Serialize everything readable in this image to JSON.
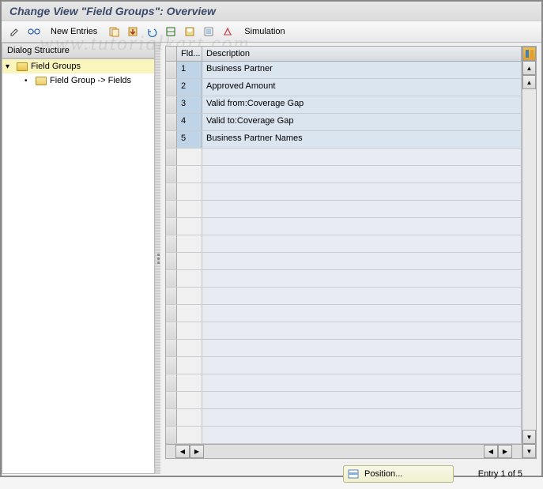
{
  "title": "Change View \"Field Groups\": Overview",
  "toolbar": {
    "new_entries": "New Entries",
    "simulation": "Simulation"
  },
  "sidebar": {
    "header": "Dialog Structure",
    "items": [
      {
        "label": "Field Groups",
        "selected": true,
        "level": 0
      },
      {
        "label": "Field Group -> Fields",
        "selected": false,
        "level": 1
      }
    ]
  },
  "table": {
    "columns": [
      "Fld...",
      "Description"
    ],
    "rows": [
      {
        "fld": "1",
        "desc": "Business Partner"
      },
      {
        "fld": "2",
        "desc": "Approved Amount"
      },
      {
        "fld": "3",
        "desc": "Valid from:Coverage Gap"
      },
      {
        "fld": "4",
        "desc": "Valid to:Coverage Gap"
      },
      {
        "fld": "5",
        "desc": "Business Partner Names"
      }
    ],
    "empty_rows": 17
  },
  "footer": {
    "position_btn": "Position...",
    "entry_text": "Entry 1 of 5"
  },
  "watermark": "www.tutorialkart.com"
}
